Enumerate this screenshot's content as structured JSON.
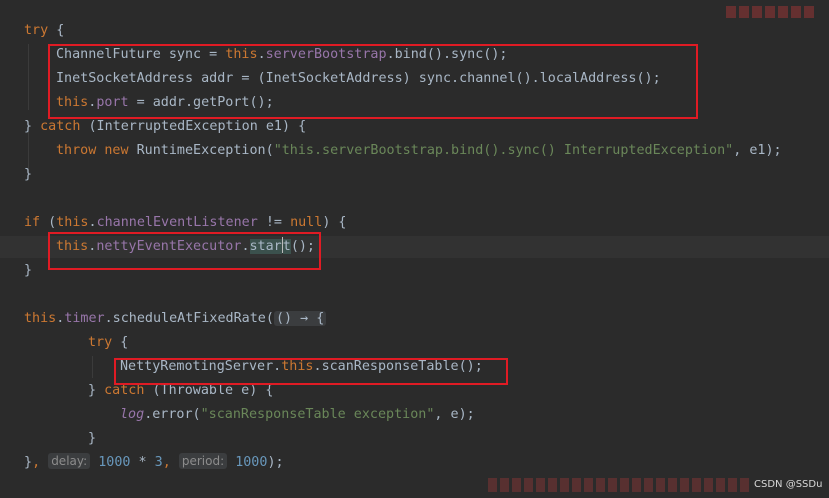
{
  "lines": {
    "l01": [
      "try",
      " {"
    ],
    "l02": [
      "ChannelFuture sync = ",
      "this",
      ".",
      "serverBootstrap",
      ".bind().sync();"
    ],
    "l03": [
      "InetSocketAddress addr = (InetSocketAddress) sync.channel().localAddress();"
    ],
    "l04": [
      "this",
      ".",
      "port",
      " = addr.getPort();"
    ],
    "l05": [
      "} ",
      "catch",
      " (InterruptedException e1) {"
    ],
    "l06": [
      "throw",
      " ",
      "new",
      " RuntimeException(",
      "\"this.serverBootstrap.bind().sync() InterruptedException\"",
      ", e1);"
    ],
    "l07": [
      "}"
    ],
    "l09": [
      "if",
      " (",
      "this",
      ".",
      "channelEventListener",
      " != ",
      "null",
      ") {"
    ],
    "l10": [
      "this",
      ".",
      "nettyEventExecutor",
      ".",
      "star",
      "t",
      "();"
    ],
    "l11": [
      "}"
    ],
    "l13": [
      "this",
      ".",
      "timer",
      ".scheduleAtFixedRate(",
      "() → {"
    ],
    "l14": [
      "try",
      " {"
    ],
    "l15": [
      "NettyRemotingServer.",
      "this",
      ".",
      "scanResponseTable",
      "();"
    ],
    "l16": [
      "} ",
      "catch",
      " (Throwable e) {"
    ],
    "l17": [
      "log",
      ".error(",
      "\"scanResponseTable exception\"",
      ", e);"
    ],
    "l18": [
      "}"
    ],
    "l19": [
      "}",
      ", ",
      "delay:",
      " ",
      "1000",
      " * ",
      "3",
      ", ",
      "period:",
      " ",
      "1000",
      ");"
    ]
  },
  "watermark_bottom": "CSDN @SSDu"
}
